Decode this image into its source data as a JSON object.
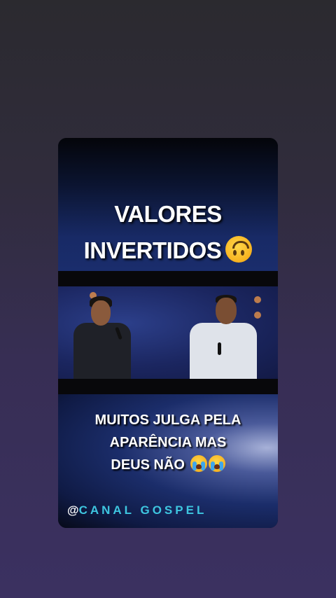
{
  "story": {
    "title_lines": [
      "VALORES",
      "INVERTIDOS"
    ],
    "title_emoji": "upside-down-face",
    "caption_lines": [
      "MUITOS JULGA PELA",
      "APARÊNCIA MAS",
      "DEUS NÃO"
    ],
    "caption_emoji": "loudly-crying-face",
    "watermark_at": "@",
    "watermark_brand": "CANAL GOSPEL"
  },
  "colors": {
    "background_top": "#2b2a2f",
    "background_bottom": "#3b3161",
    "title_panel": "#1a2d6c",
    "watermark_brand": "#3ec6e0",
    "text": "#ffffff"
  }
}
